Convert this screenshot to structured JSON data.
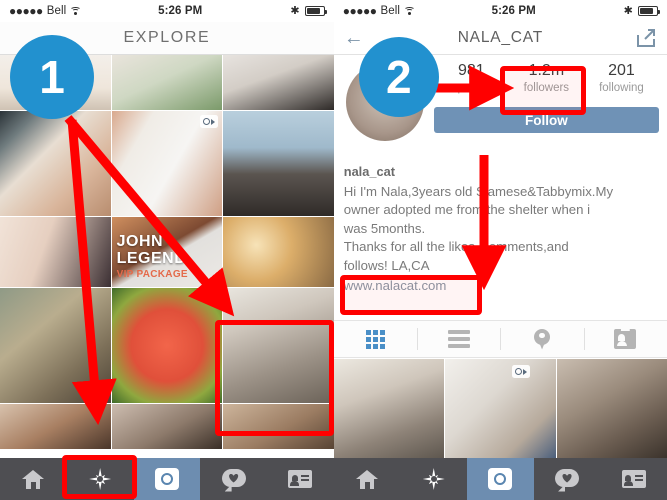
{
  "statusbar": {
    "signal_dots": "●●●●●",
    "carrier": "Bell",
    "time": "5:26 PM",
    "wifi_icon": "wifi-icon",
    "bluetooth_icon": "bluetooth-icon",
    "bluetooth_glyph": "",
    "battery_icon": "battery-icon"
  },
  "explore_panel": {
    "header_title": "EXPLORE",
    "grid_captions": {
      "john_legend_line1": "JOHN",
      "john_legend_line2": "LEGEND",
      "john_legend_line3": "VIP PACKAGE"
    },
    "video_badge_icon": "video-camera-icon"
  },
  "profile_panel": {
    "nav": {
      "back_icon": "back-arrow-icon",
      "title": "NALA_CAT",
      "share_icon": "share-icon"
    },
    "avatar_icon": "profile-avatar",
    "stats": [
      {
        "num": "981",
        "label": "posts"
      },
      {
        "num": "1.2m",
        "label": "followers"
      },
      {
        "num": "201",
        "label": "following"
      }
    ],
    "follow_button": "Follow",
    "bio": {
      "username": "nala_cat",
      "line1": "Hi I'm Nala,3years old Siamese&Tabbymix.My",
      "line2": "owner adopted me from the shelter when i",
      "line3": "was 5months.",
      "line4": "Thanks for all the likes, comments,and",
      "line5": "follows! LA,CA",
      "url": "www.nalacat.com"
    },
    "tabs": [
      {
        "name": "grid-view",
        "icon": "grid-icon",
        "selected": true
      },
      {
        "name": "list-view",
        "icon": "list-icon",
        "selected": false
      },
      {
        "name": "map-view",
        "icon": "location-pin-icon",
        "selected": false
      },
      {
        "name": "tagged-view",
        "icon": "photos-of-you-icon",
        "selected": false
      }
    ]
  },
  "bottom_nav": [
    {
      "name": "home",
      "icon": "home-icon"
    },
    {
      "name": "explore",
      "icon": "compass-icon"
    },
    {
      "name": "camera",
      "icon": "camera-icon"
    },
    {
      "name": "activity",
      "icon": "heart-speech-icon"
    },
    {
      "name": "profile",
      "icon": "profile-card-icon"
    }
  ],
  "annotations": {
    "step1_badge": "1",
    "step2_badge": "2",
    "badge_color": "#2291cf",
    "highlight_color": "#ff0000",
    "highlights": [
      "explore-tab-bottom-nav",
      "cat-photo-in-explore-grid",
      "followers-count",
      "profile-website-url"
    ]
  }
}
